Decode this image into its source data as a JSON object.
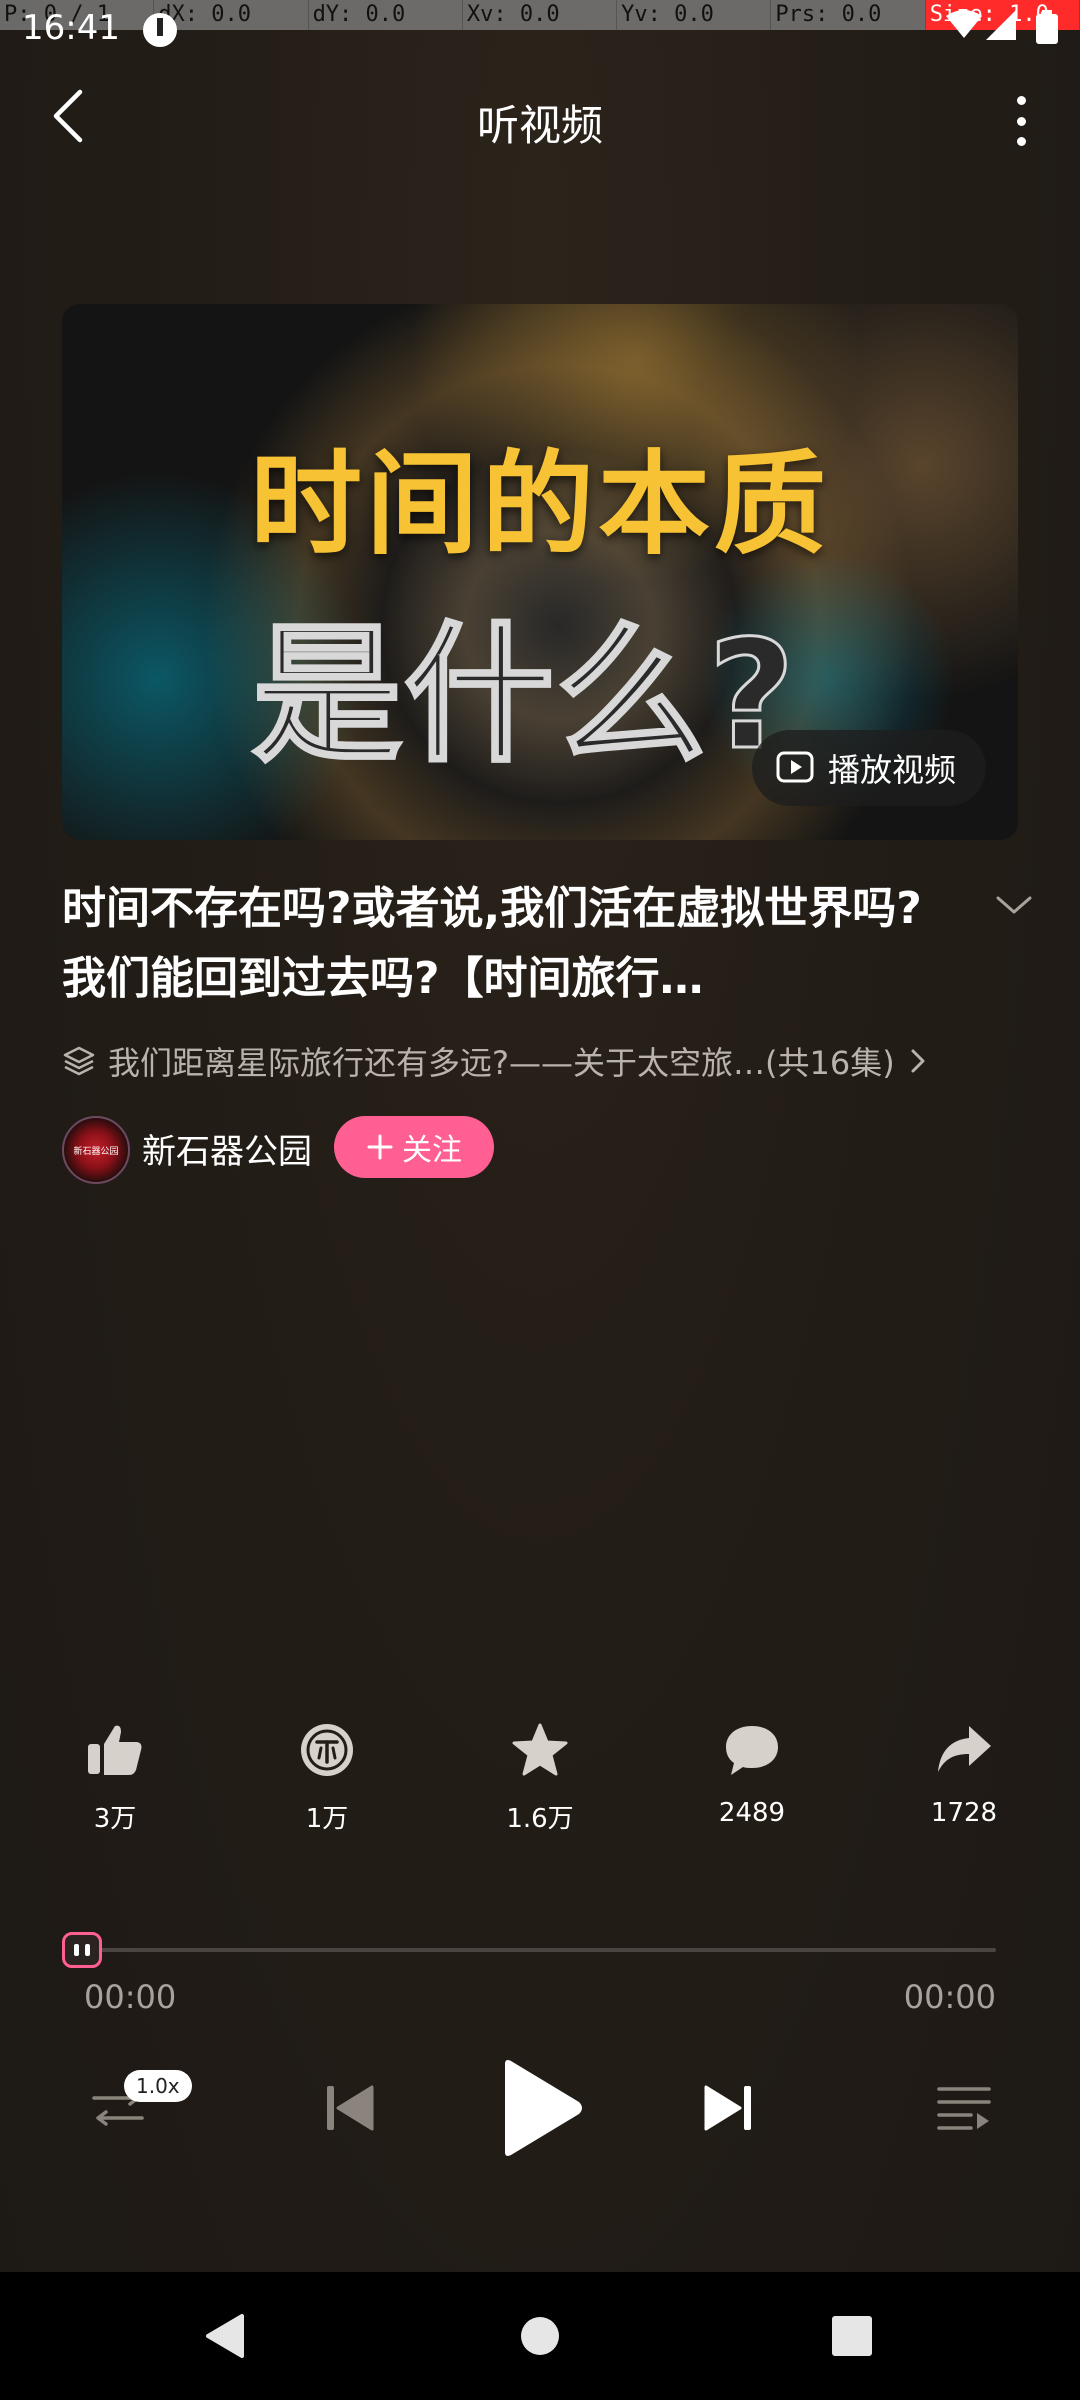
{
  "debug_overlay": {
    "p": "P: 0 / 1",
    "dx": "dX: 0.0",
    "dy": "dY: 0.0",
    "xv": "Xv: 0.0",
    "yv": "Yv: 0.0",
    "prs": "Prs: 0.0",
    "size": "Size: 1.0"
  },
  "status_bar": {
    "time": "16:41"
  },
  "header": {
    "title": "听视频"
  },
  "cover": {
    "title_line1": "时间的本质",
    "title_line2": "是什么?",
    "play_video_label": "播放视频"
  },
  "video": {
    "title": "时间不存在吗?或者说,我们活在虚拟世界吗?我们能回到过去吗?【时间旅行…",
    "series": "我们距离星际旅行还有多远?——关于太空旅…(共16集)"
  },
  "author": {
    "avatar_text": "新石器公园",
    "name": "新石器公园",
    "follow_label": "关注"
  },
  "actions": [
    {
      "name": "like",
      "count": "3万"
    },
    {
      "name": "coin",
      "count": "1万"
    },
    {
      "name": "favorite",
      "count": "1.6万"
    },
    {
      "name": "comment",
      "count": "2489"
    },
    {
      "name": "share",
      "count": "1728"
    }
  ],
  "player": {
    "progress": 0.0,
    "current_time": "00:00",
    "total_time": "00:00",
    "speed": "1.0x"
  },
  "colors": {
    "accent": "#ff5f92",
    "cover_title": "#f7c233",
    "background": "#231d17"
  }
}
